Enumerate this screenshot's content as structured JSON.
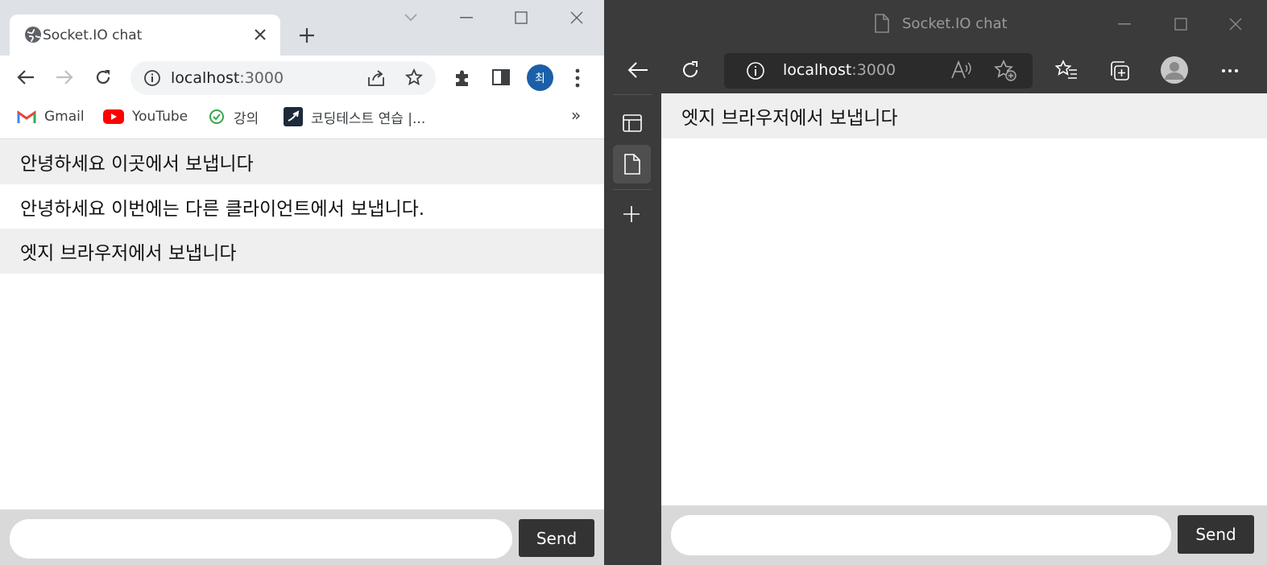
{
  "chrome": {
    "tab_title": "Socket.IO chat",
    "url_host": "localhost",
    "url_port": ":3000",
    "profile_initial": "최",
    "bookmarks": [
      {
        "label": "Gmail",
        "icon": "gmail-icon"
      },
      {
        "label": "YouTube",
        "icon": "youtube-icon"
      },
      {
        "label": "강의",
        "icon": "lecture-icon"
      },
      {
        "label": "코딩테스트 연습 |...",
        "icon": "programmers-icon"
      }
    ],
    "bookmarks_overflow": "»",
    "messages": [
      "안녕하세요 이곳에서 보냅니다",
      "안녕하세요 이번에는 다른 클라이언트에서 보냅니다.",
      "엣지 브라우저에서 보냅니다"
    ],
    "input_value": "",
    "send_label": "Send"
  },
  "edge": {
    "title": "Socket.IO chat",
    "url_host": "localhost",
    "url_port": ":3000",
    "messages": [
      "엣지 브라우저에서 보냅니다"
    ],
    "input_value": "",
    "send_label": "Send"
  },
  "colors": {
    "chrome_frame": "#dee1e6",
    "edge_frame": "#3b3b3b",
    "message_alt_bg": "#efefef",
    "form_bg": "#d9d9d9",
    "send_button": "#333333",
    "profile_badge": "#1a5fa8"
  }
}
